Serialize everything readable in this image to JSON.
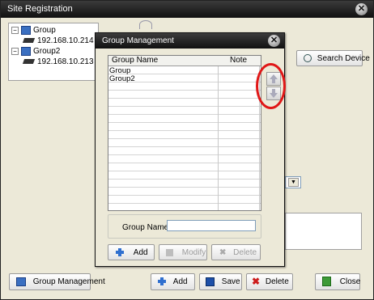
{
  "main_window": {
    "title": "Site Registration",
    "tree": [
      {
        "label": "Group",
        "kind": "group",
        "expander": "−"
      },
      {
        "label": "192.168.10.214",
        "kind": "device"
      },
      {
        "label": "Group2",
        "kind": "group",
        "expander": "−"
      },
      {
        "label": "192.168.10.213",
        "kind": "device"
      }
    ],
    "search_device_label": "Search Device",
    "group_management_label": "Group Management",
    "add_label": "Add",
    "save_label": "Save",
    "delete_label": "Delete",
    "close_label": "Close"
  },
  "dialog": {
    "title": "Group Management",
    "columns": [
      "Group Name",
      "Note"
    ],
    "rows": [
      {
        "name": "Group",
        "note": ""
      },
      {
        "name": "Group2",
        "note": ""
      }
    ],
    "group_name_label": "Group Name",
    "group_name_value": "",
    "add_label": "Add",
    "modify_label": "Modify",
    "delete_label": "Delete"
  },
  "colors": {
    "titlebar": "#1f1f1f",
    "window_bg": "#ece9d8",
    "highlight_ring": "#e01717"
  },
  "icons": {
    "close": "close-circle-icon",
    "move_up": "arrow-up-icon",
    "move_down": "arrow-down-icon"
  }
}
